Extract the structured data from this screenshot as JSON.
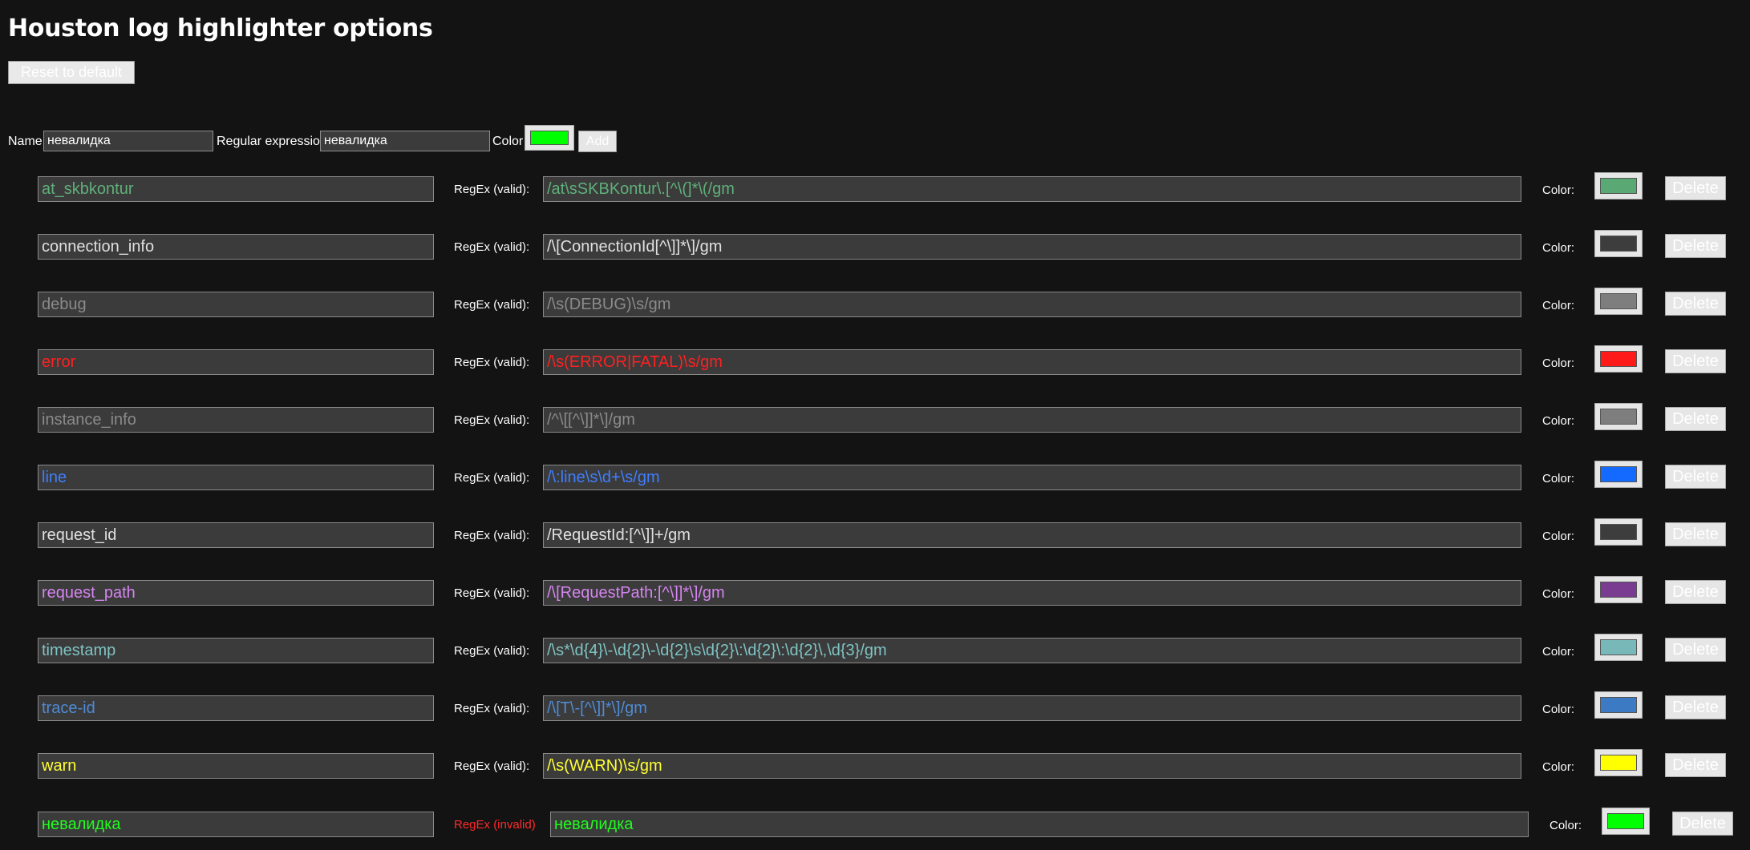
{
  "page": {
    "title": "Houston log highlighter options"
  },
  "toolbar": {
    "reset_label": "Reset to default"
  },
  "add_form": {
    "name_label": "Name",
    "name_value": "невалидка",
    "regex_label": "Regular expression",
    "regex_value": "невалидка",
    "color_label": "Color",
    "color_value": "#00ff00",
    "add_label": "Add"
  },
  "rules": [
    {
      "name": "at_skbkontur",
      "status": "RegEx (valid):",
      "regex": "/at\\sSKBKontur\\.[^\\(]*\\(/gm",
      "color": "#5aa874"
    },
    {
      "name": "connection_info",
      "status": "RegEx (valid):",
      "regex": "/\\[ConnectionId[^\\]]*\\]/gm",
      "color": "#3d3d3d"
    },
    {
      "name": "debug",
      "status": "RegEx (valid):",
      "regex": "/\\s(DEBUG)\\s/gm",
      "color": "#7e7e7e"
    },
    {
      "name": "error",
      "status": "RegEx (valid):",
      "regex": "/\\s(ERROR|FATAL)\\s/gm",
      "color": "#ff1a1a"
    },
    {
      "name": "instance_info",
      "status": "RegEx (valid):",
      "regex": "/^\\[[^\\]]*\\]/gm",
      "color": "#7e7e7e"
    },
    {
      "name": "line",
      "status": "RegEx (valid):",
      "regex": "/\\:line\\s\\d+\\s/gm",
      "color": "#1469ff"
    },
    {
      "name": "request_id",
      "status": "RegEx (valid):",
      "regex": "/RequestId:[^\\]]+/gm",
      "color": "#3d3d3d"
    },
    {
      "name": "request_path",
      "status": "RegEx (valid):",
      "regex": "/\\[RequestPath:[^\\]]*\\]/gm",
      "color": "#7a3c91"
    },
    {
      "name": "timestamp",
      "status": "RegEx (valid):",
      "regex": "/\\s*\\d{4}\\-\\d{2}\\-\\d{2}\\s\\d{2}\\:\\d{2}\\:\\d{2}\\,\\d{3}/gm",
      "color": "#78b8b8"
    },
    {
      "name": "trace-id",
      "status": "RegEx (valid):",
      "regex": "/\\[T\\-[^\\]]*\\]/gm",
      "color": "#3d7ac4"
    },
    {
      "name": "warn",
      "status": "RegEx (valid):",
      "regex": "/\\s(WARN)\\s/gm",
      "color": "#ffff00"
    },
    {
      "name": "невалидка",
      "status": "RegEx (invalid)",
      "regex": "невалидка",
      "color": "#00ff00"
    }
  ],
  "rule_text_colors": [
    "#5fb07a",
    "#e0e0e0",
    "#8a8a8a",
    "#ff2020",
    "#8a8a8a",
    "#3f7fff",
    "#e0e0e0",
    "#d585f0",
    "#7fc4c4",
    "#4f8bd6",
    "#ffff33",
    "#1fff1f"
  ],
  "labels": {
    "color": "Color:",
    "delete": "Delete"
  }
}
